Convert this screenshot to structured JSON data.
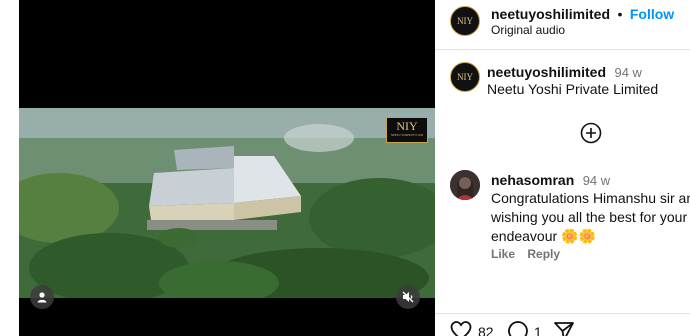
{
  "header": {
    "username": "neetuyoshilimited",
    "separator": "•",
    "follow_label": "Follow",
    "audio_label": "Original audio",
    "avatar_text": "NIY"
  },
  "caption": {
    "username": "neetuyoshilimited",
    "time": "94 w",
    "text": "Neetu Yoshi Private Limited",
    "avatar_text": "NIY"
  },
  "load_more": {
    "icon": "plus-circle-icon"
  },
  "comment": {
    "username": "nehasomran",
    "time": "94 w",
    "line1": "Congratulations Himanshu sir and",
    "line2": "wishing you all the best for your f",
    "line3": "endeavour",
    "emoji": "🌼🌼",
    "like_label": "Like",
    "reply_label": "Reply"
  },
  "actions": {
    "likes_count": "82",
    "comments_count": "1"
  },
  "video": {
    "watermark": "NIY",
    "watermark_sub": "NEETU YOSHI PVT LTD"
  },
  "colors": {
    "accent": "#0095f6",
    "video_bg": "#000000"
  }
}
